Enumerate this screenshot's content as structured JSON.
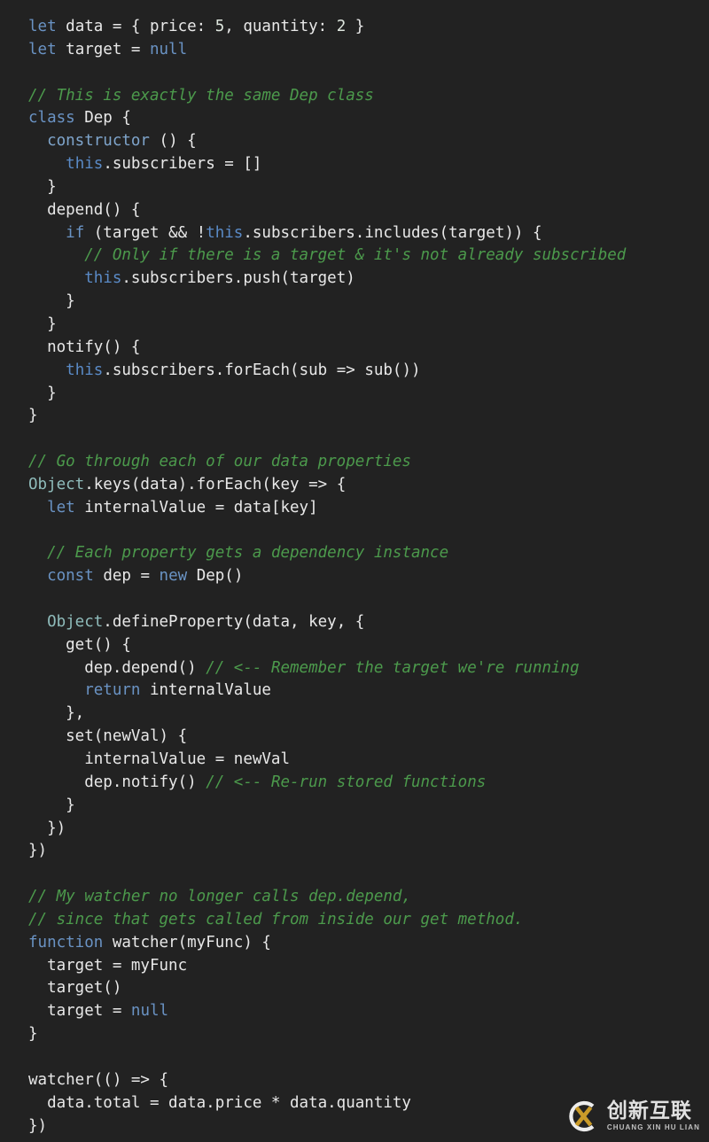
{
  "editor": {
    "language": "javascript",
    "background_color": "#222222",
    "default_text_color": "#e8e8e8",
    "colors": {
      "keyword": "#6a93c4",
      "method": "#7fa5cc",
      "this": "#5a8ac6",
      "builtin_object": "#8fbcbb",
      "comment": "#4c9a4c",
      "number": "#dfe7df"
    },
    "lines": [
      "let data = { price: 5, quantity: 2 }",
      "let target = null",
      "",
      "// This is exactly the same Dep class",
      "class Dep {",
      "  constructor () {",
      "    this.subscribers = []",
      "  }",
      "  depend() {",
      "    if (target && !this.subscribers.includes(target)) {",
      "      // Only if there is a target & it's not already subscribed",
      "      this.subscribers.push(target)",
      "    }",
      "  }",
      "  notify() {",
      "    this.subscribers.forEach(sub => sub())",
      "  }",
      "}",
      "",
      "// Go through each of our data properties",
      "Object.keys(data).forEach(key => {",
      "  let internalValue = data[key]",
      "",
      "  // Each property gets a dependency instance",
      "  const dep = new Dep()",
      "",
      "  Object.defineProperty(data, key, {",
      "    get() {",
      "      dep.depend() // <-- Remember the target we're running",
      "      return internalValue",
      "    },",
      "    set(newVal) {",
      "      internalValue = newVal",
      "      dep.notify() // <-- Re-run stored functions",
      "    }",
      "  })",
      "})",
      "",
      "// My watcher no longer calls dep.depend,",
      "// since that gets called from inside our get method.",
      "function watcher(myFunc) {",
      "  target = myFunc",
      "  target()",
      "  target = null",
      "}",
      "",
      "watcher(() => {",
      "  data.total = data.price * data.quantity",
      "})"
    ]
  },
  "watermark": {
    "logo_name": "cx-circle-logo",
    "brand_cn": "创新互联",
    "brand_pinyin": "CHUANG XIN HU LIAN",
    "ring_color": "#ffffff",
    "x_color": "#d9a62a"
  }
}
